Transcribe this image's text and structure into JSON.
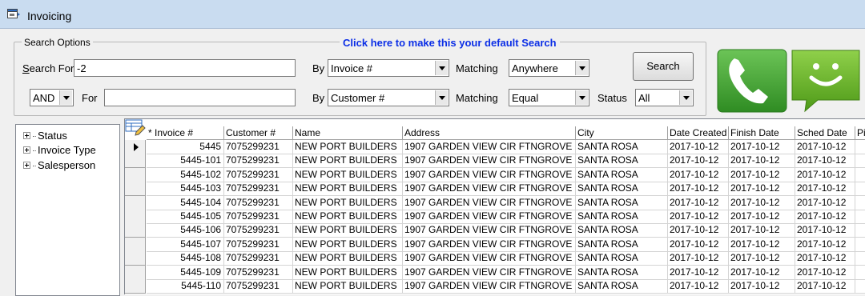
{
  "window": {
    "title": "Invoicing"
  },
  "search": {
    "legend": "Search Options",
    "default_link": "Click here to make this your default Search",
    "search_for_label_u": "S",
    "search_for_label_rest": "earch For",
    "search_for_value": "-2",
    "by_label": "By",
    "by1_value": "Invoice #",
    "matching_label": "Matching",
    "matching1_value": "Anywhere",
    "search_button": "Search",
    "logic_value": "AND",
    "for_label": "For",
    "for_value": "",
    "by2_value": "Customer #",
    "matching2_value": "Equal",
    "status_label": "Status",
    "status_value": "All"
  },
  "tree": {
    "items": [
      "Status",
      "Invoice Type",
      "Salesperson"
    ]
  },
  "grid": {
    "columns": [
      "* Invoice #",
      "Customer #",
      "Name",
      "Address",
      "City",
      "Date Created",
      "Finish Date",
      "Sched Date",
      "Pi"
    ],
    "rows": [
      [
        "5445",
        "7075299231",
        "NEW PORT BUILDERS",
        "1907 GARDEN VIEW CIR FTNGROVE",
        "SANTA ROSA",
        "2017-10-12",
        "2017-10-12",
        "2017-10-12"
      ],
      [
        "5445-101",
        "7075299231",
        "NEW PORT BUILDERS",
        "1907 GARDEN VIEW CIR FTNGROVE",
        "SANTA ROSA",
        "2017-10-12",
        "2017-10-12",
        "2017-10-12"
      ],
      [
        "5445-102",
        "7075299231",
        "NEW PORT BUILDERS",
        "1907 GARDEN VIEW CIR FTNGROVE",
        "SANTA ROSA",
        "2017-10-12",
        "2017-10-12",
        "2017-10-12"
      ],
      [
        "5445-103",
        "7075299231",
        "NEW PORT BUILDERS",
        "1907 GARDEN VIEW CIR FTNGROVE",
        "SANTA ROSA",
        "2017-10-12",
        "2017-10-12",
        "2017-10-12"
      ],
      [
        "5445-104",
        "7075299231",
        "NEW PORT BUILDERS",
        "1907 GARDEN VIEW CIR FTNGROVE",
        "SANTA ROSA",
        "2017-10-12",
        "2017-10-12",
        "2017-10-12"
      ],
      [
        "5445-105",
        "7075299231",
        "NEW PORT BUILDERS",
        "1907 GARDEN VIEW CIR FTNGROVE",
        "SANTA ROSA",
        "2017-10-12",
        "2017-10-12",
        "2017-10-12"
      ],
      [
        "5445-106",
        "7075299231",
        "NEW PORT BUILDERS",
        "1907 GARDEN VIEW CIR FTNGROVE",
        "SANTA ROSA",
        "2017-10-12",
        "2017-10-12",
        "2017-10-12"
      ],
      [
        "5445-107",
        "7075299231",
        "NEW PORT BUILDERS",
        "1907 GARDEN VIEW CIR FTNGROVE",
        "SANTA ROSA",
        "2017-10-12",
        "2017-10-12",
        "2017-10-12"
      ],
      [
        "5445-108",
        "7075299231",
        "NEW PORT BUILDERS",
        "1907 GARDEN VIEW CIR FTNGROVE",
        "SANTA ROSA",
        "2017-10-12",
        "2017-10-12",
        "2017-10-12"
      ],
      [
        "5445-109",
        "7075299231",
        "NEW PORT BUILDERS",
        "1907 GARDEN VIEW CIR FTNGROVE",
        "SANTA ROSA",
        "2017-10-12",
        "2017-10-12",
        "2017-10-12"
      ],
      [
        "5445-110",
        "7075299231",
        "NEW PORT BUILDERS",
        "1907 GARDEN VIEW CIR FTNGROVE",
        "SANTA ROSA",
        "2017-10-12",
        "2017-10-12",
        "2017-10-12"
      ]
    ]
  },
  "icons": {
    "phone": "phone-icon",
    "sms": "sms-icon",
    "window": "window-app-icon",
    "edit": "edit-grid-icon"
  },
  "colors": {
    "link": "#0b2ee6",
    "phone_green": "#3f9d2e",
    "sms_green": "#66b52a"
  }
}
